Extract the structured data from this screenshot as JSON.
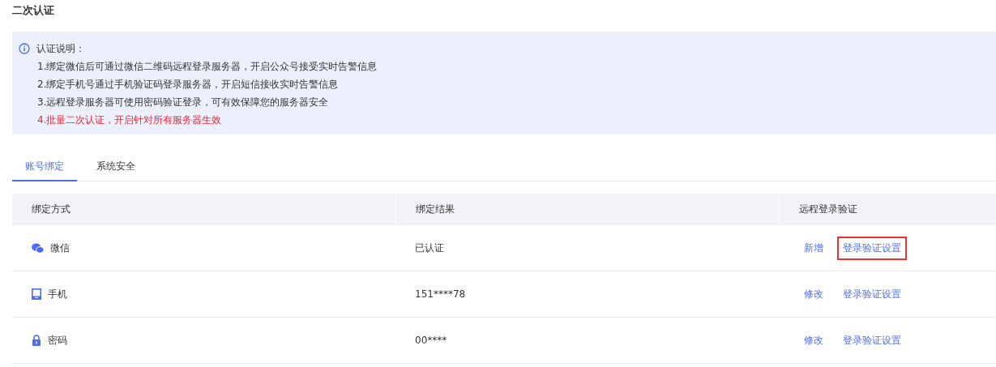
{
  "title": "二次认证",
  "notice": {
    "heading": "认证说明：",
    "lines": [
      {
        "text": "1.绑定微信后可通过微信二维码远程登录服务器，开启公众号接受实时告警信息",
        "warning": false
      },
      {
        "text": "2.绑定手机号通过手机验证码登录服务器，开启短信接收实时告警信息",
        "warning": false
      },
      {
        "text": "3.远程登录服务器可使用密码验证登录，可有效保障您的服务器安全",
        "warning": false
      },
      {
        "text": "4.批量二次认证，开启针对所有服务器生效",
        "warning": true
      }
    ]
  },
  "tabs": [
    {
      "label": "账号绑定",
      "selected": true
    },
    {
      "label": "系统安全",
      "selected": false
    }
  ],
  "table": {
    "columns": [
      "绑定方式",
      "绑定结果",
      "远程登录验证"
    ],
    "rows": [
      {
        "kind": "wechat",
        "method": "微信",
        "result": "已认证",
        "actions": [
          {
            "label": "新增",
            "highlighted": false
          },
          {
            "label": "登录验证设置",
            "highlighted": true
          }
        ]
      },
      {
        "kind": "phone",
        "method": "手机",
        "result": "151****78",
        "actions": [
          {
            "label": "修改",
            "highlighted": false
          },
          {
            "label": "登录验证设置",
            "highlighted": false
          }
        ]
      },
      {
        "kind": "password",
        "method": "密码",
        "result": "00****",
        "actions": [
          {
            "label": "修改",
            "highlighted": false
          },
          {
            "label": "登录验证设置",
            "highlighted": false
          }
        ]
      }
    ]
  }
}
